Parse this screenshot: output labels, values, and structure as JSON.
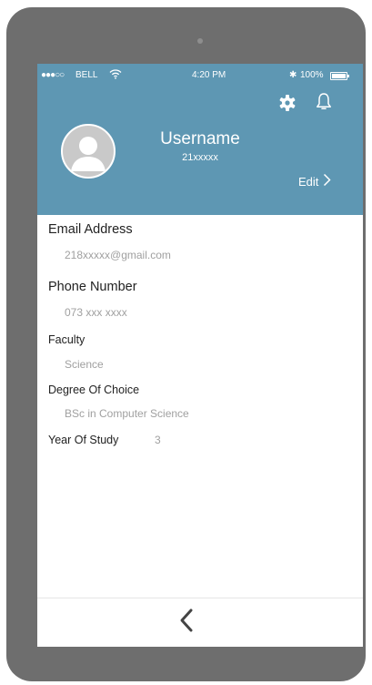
{
  "status_bar": {
    "signal": "●●●○○",
    "carrier": "BELL",
    "time": "4:20 PM",
    "bluetooth": "✱",
    "battery": "100%"
  },
  "header": {
    "username": "Username",
    "user_id": "21xxxxx",
    "edit_label": "Edit",
    "icons": [
      "gear-icon",
      "bell-icon",
      "user-avatar-icon",
      "chevron-right-icon"
    ]
  },
  "profile": {
    "email_label": "Email Address",
    "email_value": "218xxxxx@gmail.com",
    "phone_label": "Phone Number",
    "phone_value": "073 xxx xxxx",
    "faculty_label": "Faculty",
    "faculty_value": "Science",
    "degree_label": "Degree Of Choice",
    "degree_value": "BSc in Computer Science",
    "year_label": "Year Of Study",
    "year_value": "3"
  },
  "footer": {
    "icons": [
      "chevron-left-icon"
    ]
  },
  "colors": {
    "header_bg": "#5e97b3",
    "phone_frame": "#6e6e6e",
    "label_text": "#222222",
    "value_text": "#a0a0a0"
  }
}
